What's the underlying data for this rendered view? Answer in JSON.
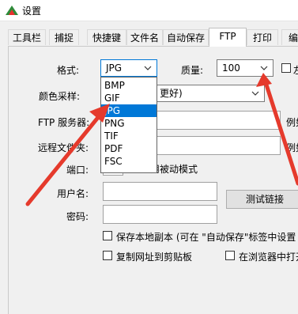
{
  "window": {
    "title": "设置"
  },
  "tabs": [
    {
      "label": "工具栏"
    },
    {
      "label": "捕捉"
    },
    {
      "label": "快捷键"
    },
    {
      "label": "文件名"
    },
    {
      "label": "自动保存"
    },
    {
      "label": "FTP"
    },
    {
      "label": "打印"
    },
    {
      "label": "编"
    }
  ],
  "active_tab": "FTP",
  "form": {
    "format_label": "格式:",
    "format_value": "JPG",
    "quality_label": "质量:",
    "quality_value": "100",
    "extra_checkbox_label": "左",
    "color_sampling_label": "颜色采样:",
    "color_sampling_value": "更好)",
    "ftp_server_label": "FTP 服务器:",
    "ftp_server_hint": "例如",
    "remote_file_label": "远程文件夹",
    "remote_file_label_suffix": ":",
    "remote_file_hint": "例如",
    "port_label": "端口:",
    "passive_mode_label": "用被动模式",
    "username_label": "用户名:",
    "password_label": "密码:",
    "test_link_button": "测试链接",
    "save_local_copy_label": "保存本地副本 (可在 \"自动保存\"标签中设置",
    "copy_url_label": "复制网址到剪贴板",
    "open_in_browser_label": "在浏览器中打开"
  },
  "format_dropdown": {
    "options": [
      "BMP",
      "GIF",
      "JPG",
      "PNG",
      "TIF",
      "PDF",
      "FSC"
    ],
    "selected": "JPG"
  },
  "colors": {
    "accent": "#0078d7",
    "annotation_arrow": "#e53a2c"
  }
}
